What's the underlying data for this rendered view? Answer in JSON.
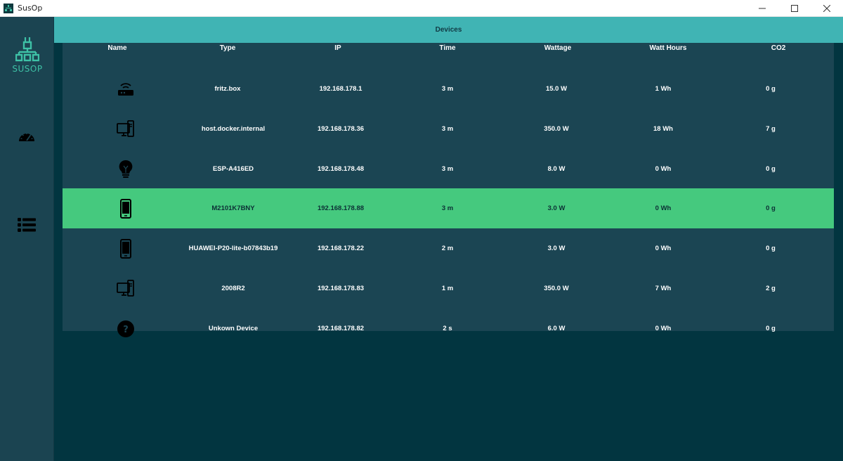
{
  "window": {
    "title": "SusOp",
    "min_icon": "minimize-icon",
    "max_icon": "maximize-icon",
    "close_icon": "close-icon"
  },
  "sidebar": {
    "logo_text": "SUSOP",
    "items": [
      {
        "icon": "speedometer-icon"
      },
      {
        "icon": "list-icon"
      }
    ]
  },
  "header": {
    "title": "Devices"
  },
  "table": {
    "columns": [
      "Name",
      "Type",
      "IP",
      "Time",
      "Wattage",
      "Watt Hours",
      "CO2"
    ],
    "rows": [
      {
        "icon": "router-icon",
        "type": "fritz.box",
        "ip": "192.168.178.1",
        "time": "3 m",
        "wattage": "15.0 W",
        "watt_hours": "1 Wh",
        "co2": "0 g",
        "selected": false
      },
      {
        "icon": "desktop-icon",
        "type": "host.docker.internal",
        "ip": "192.168.178.36",
        "time": "3 m",
        "wattage": "350.0 W",
        "watt_hours": "18 Wh",
        "co2": "7 g",
        "selected": false
      },
      {
        "icon": "lightbulb-icon",
        "type": "ESP-A416ED",
        "ip": "192.168.178.48",
        "time": "3 m",
        "wattage": "8.0 W",
        "watt_hours": "0 Wh",
        "co2": "0 g",
        "selected": false
      },
      {
        "icon": "phone-icon",
        "type": "M2101K7BNY",
        "ip": "192.168.178.88",
        "time": "3 m",
        "wattage": "3.0 W",
        "watt_hours": "0 Wh",
        "co2": "0 g",
        "selected": true
      },
      {
        "icon": "phone-icon",
        "type": "HUAWEI-P20-lite-b07843b19",
        "ip": "192.168.178.22",
        "time": "2 m",
        "wattage": "3.0 W",
        "watt_hours": "0 Wh",
        "co2": "0 g",
        "selected": false
      },
      {
        "icon": "desktop-icon",
        "type": "2008R2",
        "ip": "192.168.178.83",
        "time": "1 m",
        "wattage": "350.0 W",
        "watt_hours": "7 Wh",
        "co2": "2 g",
        "selected": false
      },
      {
        "icon": "question-icon",
        "type": "Unkown Device",
        "ip": "192.168.178.82",
        "time": "2 s",
        "wattage": "6.0 W",
        "watt_hours": "0 Wh",
        "co2": "0 g",
        "selected": false
      }
    ]
  },
  "colors": {
    "background": "#023540",
    "sidebar": "#1b4451",
    "header": "#40b4b4",
    "table": "#1b4553",
    "selected_row": "#45c97e",
    "logo": "#3ec1a6"
  }
}
